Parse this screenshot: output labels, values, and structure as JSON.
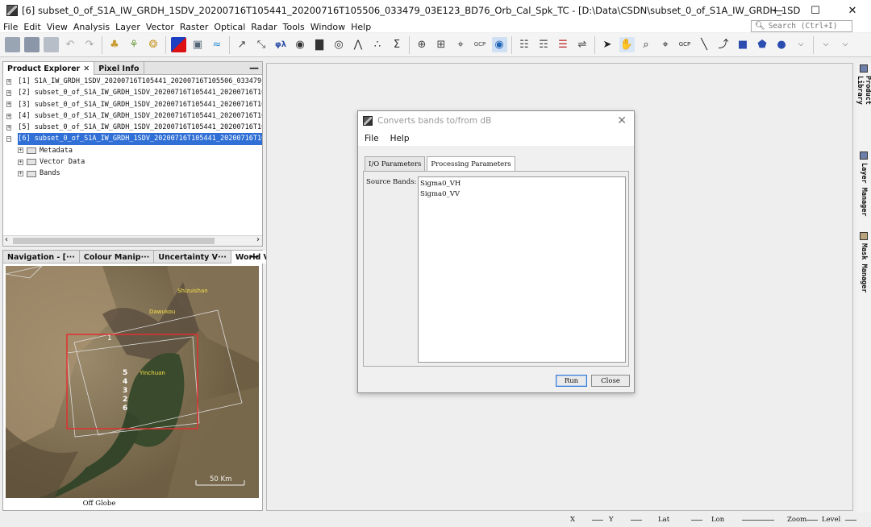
{
  "window": {
    "title": "[6] subset_0_of_S1A_IW_GRDH_1SDV_20200716T105441_20200716T105506_033479_03E123_BD76_Orb_Cal_Spk_TC - [D:\\Data\\CSDN\\subset_0_of_S1A_IW_GRDH_1SDV_20200716T105441_20200716T1055...",
    "minimize": "—",
    "maximize": "☐",
    "close": "✕"
  },
  "menu": [
    "File",
    "Edit",
    "View",
    "Analysis",
    "Layer",
    "Vector",
    "Raster",
    "Optical",
    "Radar",
    "Tools",
    "Window",
    "Help"
  ],
  "search": {
    "placeholder": "Search (Ctrl+I)"
  },
  "product_explorer": {
    "tabs": [
      "Product Explorer",
      "Pixel Info"
    ],
    "products": [
      "[1] S1A_IW_GRDH_1SDV_20200716T105441_20200716T105506_033479_0",
      "[2] subset_0_of_S1A_IW_GRDH_1SDV_20200716T105441_20200716T105",
      "[3] subset_0_of_S1A_IW_GRDH_1SDV_20200716T105441_20200716T105",
      "[4] subset_0_of_S1A_IW_GRDH_1SDV_20200716T105441_20200716T105",
      "[5] subset_0_of_S1A_IW_GRDH_1SDV_20200716T105441_20200716T105",
      "[6] subset_0_of_S1A_IW_GRDH_1SDV_20200716T105441_20200716T105"
    ],
    "children": [
      "Metadata",
      "Vector Data",
      "Bands"
    ]
  },
  "nav_panel": {
    "tabs": [
      "Navigation - [···",
      "Colour Manip···",
      "Uncertainty V···",
      "World View"
    ],
    "places": [
      "Shizuishan",
      "Dawukou",
      "Yinchuan"
    ],
    "footprint_labels": [
      "1",
      "5",
      "4",
      "3",
      "2",
      "6"
    ],
    "scale": "50 Km",
    "status": "Off Globe"
  },
  "sidebar_tools": [
    "Product Library",
    "Layer Manager",
    "Mask Manager"
  ],
  "dialog": {
    "title": "Converts bands to/from dB",
    "menu": [
      "File",
      "Help"
    ],
    "tabs": [
      "I/O Parameters",
      "Processing Parameters"
    ],
    "source_bands_label": "Source Bands:",
    "bands": [
      "Sigma0_VH",
      "Sigma0_VV"
    ],
    "run": "Run",
    "close": "Close"
  },
  "statusbar": {
    "x": "X",
    "y": "Y",
    "lat": "Lat",
    "lon": "Lon",
    "zoom": "Zoom",
    "level": "Level"
  }
}
